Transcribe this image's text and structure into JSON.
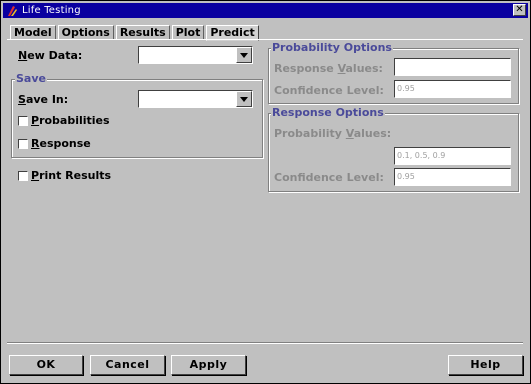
{
  "window": {
    "title": "Life Testing",
    "close_glyph": "✕"
  },
  "tabs": [
    {
      "label": "Model",
      "active": false
    },
    {
      "label": "Options",
      "active": false
    },
    {
      "label": "Results",
      "active": false
    },
    {
      "label": "Plot",
      "active": false
    },
    {
      "label": "Predict",
      "active": true
    }
  ],
  "new_data": {
    "label_mn": "N",
    "label_rest": "ew Data:",
    "value": ""
  },
  "save": {
    "title": "Save",
    "save_in_mn": "S",
    "save_in_rest": "ave In:",
    "save_in_value": "",
    "probabilities_mn": "P",
    "probabilities_rest": "robabilities",
    "probabilities_checked": false,
    "response_mn": "R",
    "response_rest": "esponse",
    "response_checked": false
  },
  "print_results": {
    "mn": "P",
    "rest": "rint Results",
    "checked": false
  },
  "probability_options": {
    "title": "Probability Options",
    "response_values_pre": "Response ",
    "response_values_mn": "V",
    "response_values_post": "alues:",
    "response_values_value": "",
    "confidence_label": "Confidence Level:",
    "confidence_value": "0.95"
  },
  "response_options": {
    "title": "Response Options",
    "probability_values_pre": "Probability ",
    "probability_values_mn": "V",
    "probability_values_post": "alues:",
    "probability_values_value": "0.1, 0.5, 0.9",
    "confidence_label": "Confidence Level:",
    "confidence_value": "0.95"
  },
  "buttons": {
    "ok": "OK",
    "cancel": "Cancel",
    "apply": "Apply",
    "help": "Help"
  },
  "colors": {
    "titlebar": "#0a00a0",
    "group_title": "#4a4a9a",
    "disabled_text": "#8a8a8a"
  }
}
